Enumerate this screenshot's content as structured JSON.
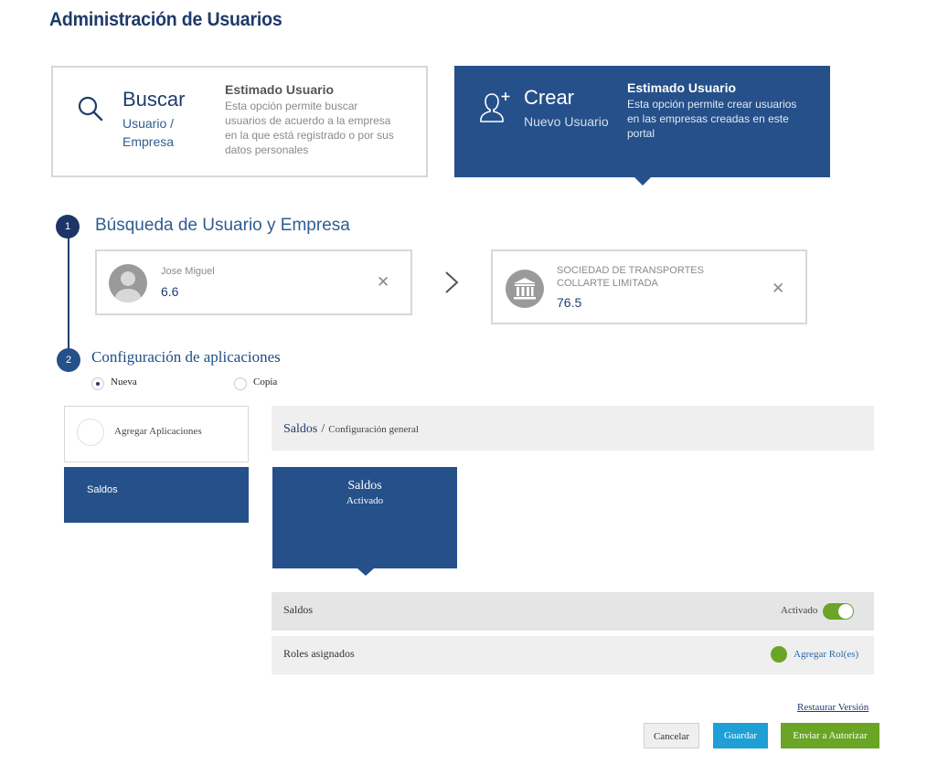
{
  "page": {
    "title": "Administración de Usuarios"
  },
  "cards": {
    "buscar": {
      "title": "Buscar",
      "subtitle_line1": "Usuario /",
      "subtitle_line2": "Empresa",
      "desc_heading": "Estimado Usuario",
      "desc_lines": [
        "Esta opción permite buscar",
        "usuarios de acuerdo a la empresa",
        "en la que está registrado o por sus",
        "datos personales"
      ],
      "icon": "search-icon"
    },
    "crear": {
      "title": "Crear",
      "subtitle": "Nuevo Usuario",
      "desc_heading": "Estimado Usuario",
      "desc_lines": [
        "Esta opción permite crear usuarios",
        "en las empresas creadas en este",
        "portal"
      ],
      "icon": "add-user-icon"
    }
  },
  "step1": {
    "number": "1",
    "title": "Búsqueda de Usuario y Empresa",
    "user": {
      "name": "Jose Miguel",
      "value": "6.6"
    },
    "company": {
      "name_line1": "SOCIEDAD DE TRANSPORTES",
      "name_line2": "COLLARTE LIMITADA",
      "value": "76.5"
    }
  },
  "step2": {
    "number": "2",
    "title": "Configuración de aplicaciones",
    "options": [
      {
        "label": "Nueva",
        "selected": true
      },
      {
        "label": "Copia",
        "selected": false
      }
    ]
  },
  "left_panel": {
    "add_label": "Agregar Aplicaciones",
    "items": [
      "Saldos"
    ]
  },
  "config": {
    "breadcrumb_main": "Saldos",
    "breadcrumb_sep": "/",
    "breadcrumb_sub": "Configuración general",
    "app_card": {
      "title": "Saldos",
      "status": "Activado"
    },
    "rows": {
      "saldos": {
        "label": "Saldos",
        "status_label": "Activado",
        "toggle_on": true
      },
      "roles": {
        "label": "Roles asignados",
        "action_label": "Agregar Rol(es)"
      }
    }
  },
  "footer": {
    "restore_label": "Restaurar Versión",
    "cancel_label": "Cancelar",
    "save_label": "Guardar",
    "submit_label": "Enviar a Autorizar"
  },
  "colors": {
    "primary": "#25508a",
    "dark": "#1c3566",
    "save": "#1ea0d6",
    "submit": "#6aa526",
    "toggle": "#6aa526",
    "link": "#2c6aa9"
  }
}
